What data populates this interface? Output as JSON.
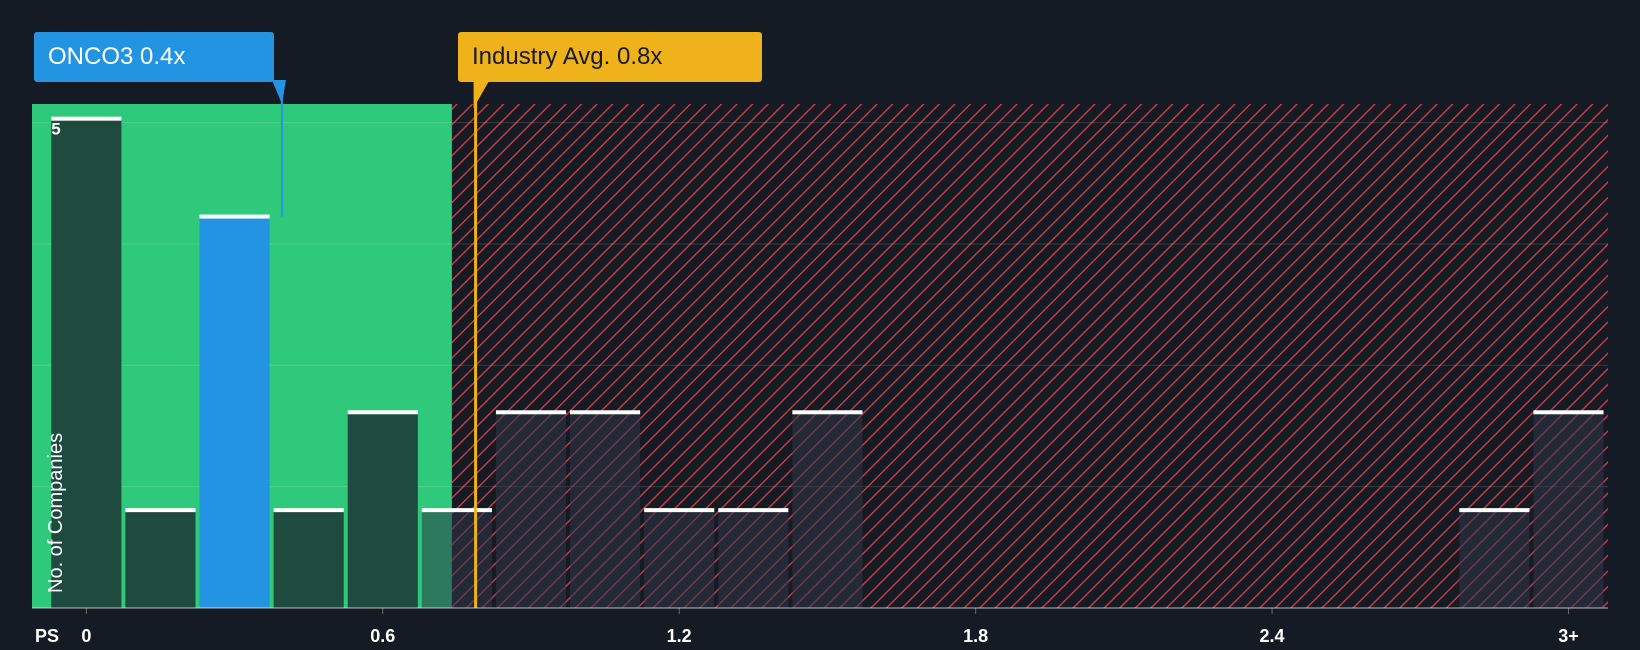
{
  "company_callout": {
    "ticker": "ONCO3",
    "value": "0.4x"
  },
  "industry_callout": {
    "label": "Industry Avg.",
    "value": "0.8x"
  },
  "colors": {
    "background": "#151b24",
    "undervalued_zone": "#2ec97a",
    "overvalued_zone": "#c23b3f",
    "company": "#2394e2",
    "industry": "#efb21a",
    "bar": "#1f4a3e",
    "bar_cap": "#ffffff",
    "axis_text": "#ffffff"
  },
  "chart_data": {
    "type": "bar",
    "title": "",
    "xlabel": "PS",
    "ylabel": "No. of Companies",
    "x_ticks": [
      "0",
      "0.6",
      "1.2",
      "1.8",
      "2.4",
      "3+"
    ],
    "x_tick_values": [
      0,
      0.6,
      1.2,
      1.8,
      2.4,
      3.0
    ],
    "y_ticks": [
      "5"
    ],
    "y_tick_values": [
      5
    ],
    "ylim": [
      0,
      5.15
    ],
    "xlim": [
      -0.11,
      3.08
    ],
    "bin_width": 0.15,
    "bins": [
      {
        "x": 0.0,
        "count": 5
      },
      {
        "x": 0.15,
        "count": 1
      },
      {
        "x": 0.3,
        "count": 4,
        "highlight": "company"
      },
      {
        "x": 0.45,
        "count": 1
      },
      {
        "x": 0.6,
        "count": 2
      },
      {
        "x": 0.75,
        "count": 1
      },
      {
        "x": 0.9,
        "count": 2
      },
      {
        "x": 1.05,
        "count": 2
      },
      {
        "x": 1.2,
        "count": 1
      },
      {
        "x": 1.35,
        "count": 1
      },
      {
        "x": 1.5,
        "count": 2
      },
      {
        "x": 2.85,
        "count": 1
      },
      {
        "x": 3.0,
        "count": 2
      }
    ],
    "company_value": 0.4,
    "industry_avg": 0.8,
    "grid": true,
    "legend": "none"
  }
}
